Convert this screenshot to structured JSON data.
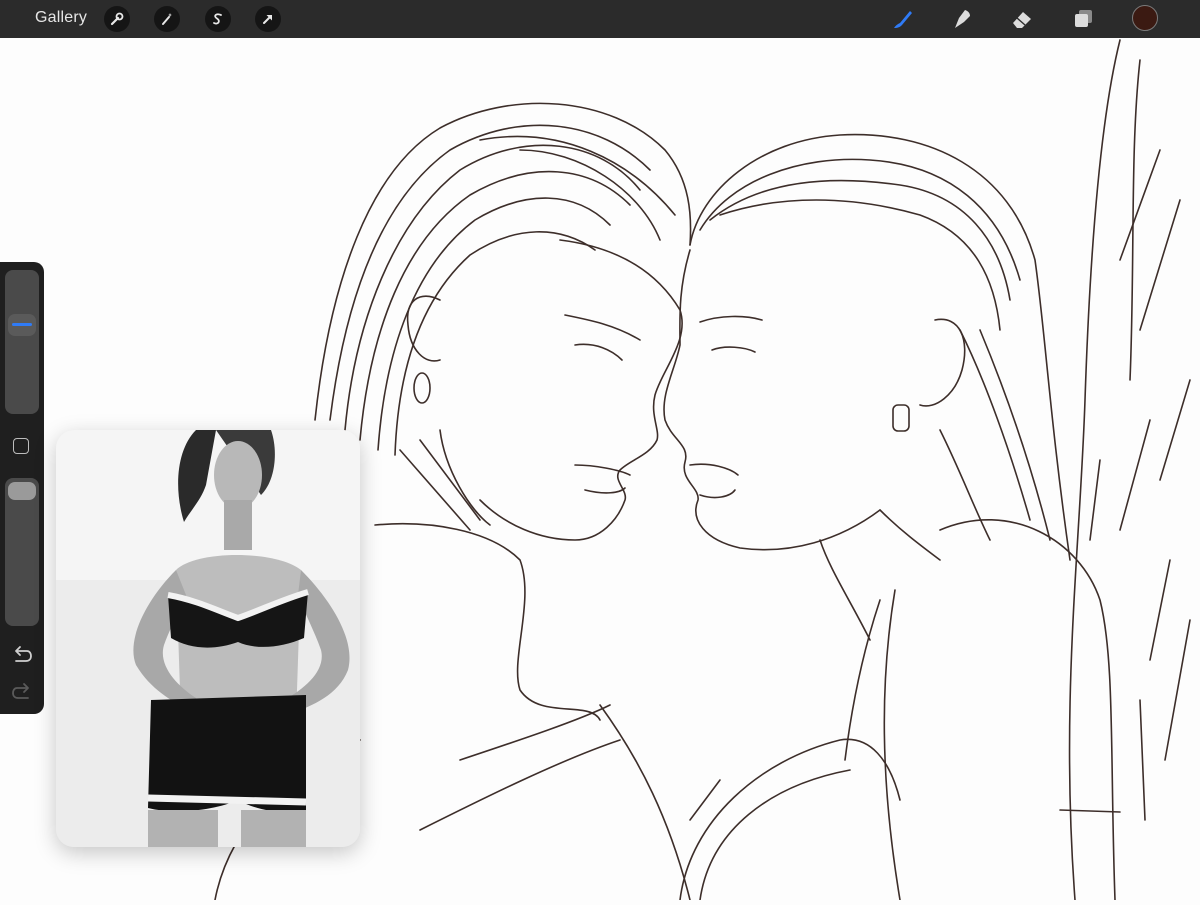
{
  "toolbar": {
    "gallery_label": "Gallery",
    "left_tools": [
      "wrench-icon",
      "magic-wand-icon",
      "selection-icon",
      "transform-arrow-icon"
    ],
    "right_tools": [
      "brush-icon",
      "smudge-icon",
      "eraser-icon",
      "layers-icon"
    ],
    "active_tool": "brush-icon",
    "active_tool_color": "#2f7bf6",
    "current_color": "#3b1a12"
  },
  "sidebar": {
    "brush_size": 0.64,
    "opacity": 1.0
  },
  "colors": {
    "toolbar_bg": "#2b2b2b",
    "canvas_bg": "#fdfdfd",
    "sketch_stroke": "#3d2e2a"
  }
}
